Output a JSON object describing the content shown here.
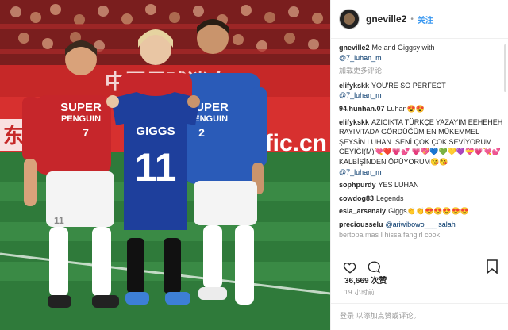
{
  "photo": {
    "banner_text": "中国足球迷会",
    "board_text": "fic.cn",
    "board_left_text": "东",
    "left_player": {
      "shirt_text_1": "SUPER",
      "shirt_text_2": "PENGUIN",
      "number": "7",
      "shorts_number": "11"
    },
    "center_player": {
      "jersey_name": "GIGGS",
      "jersey_number": "11"
    },
    "right_player": {
      "shirt_text_1": "SUPER",
      "shirt_text_2": "PENGUIN",
      "number": "2"
    }
  },
  "header": {
    "username": "gneville2",
    "follow_label": "关注"
  },
  "caption": {
    "username": "gneville2",
    "text": "Me and Giggsy with",
    "mention": "@7_luhan_m"
  },
  "load_more": "加载更多评论",
  "comments": [
    {
      "user": "elifykskk",
      "text": "YOU'RE SO PERFECT",
      "mention": "@7_luhan_m"
    },
    {
      "user": "94.hunhan.07",
      "text": "Luhan😍😍"
    },
    {
      "user": "elifykskk",
      "text": "AZICIKTA TÜRKÇE YAZAYIM EEHEHEH RAYIMTADA GÖRDÜĞÜM EN MÜKEMMEL ŞEYSİN LUHAN. SENİ ÇOK ÇOK SEVİYORUM GEYİĞİ(M)💘❤️💗💕 💗💖💙💚💛💜💝💗💘💕 KALBİŞİNDEN ÖPÜYORUM😘😘",
      "mention": "@7_luhan_m"
    },
    {
      "user": "sophpurdy",
      "text": "YES LUHAN"
    },
    {
      "user": "cowdog83",
      "text": "Legends"
    },
    {
      "user": "esia_arsenaly",
      "text": "Giggs👏👏😍😍😍😍😍"
    },
    {
      "user": "preciousselu",
      "text": "@ariwibowo___ salah",
      "cut": "bertopa mas I hissa fangirl cook"
    }
  ],
  "likes": "36,669 次赞",
  "ago": "19 小时前",
  "login_prompt": "登录 以添加点赞或评论。"
}
